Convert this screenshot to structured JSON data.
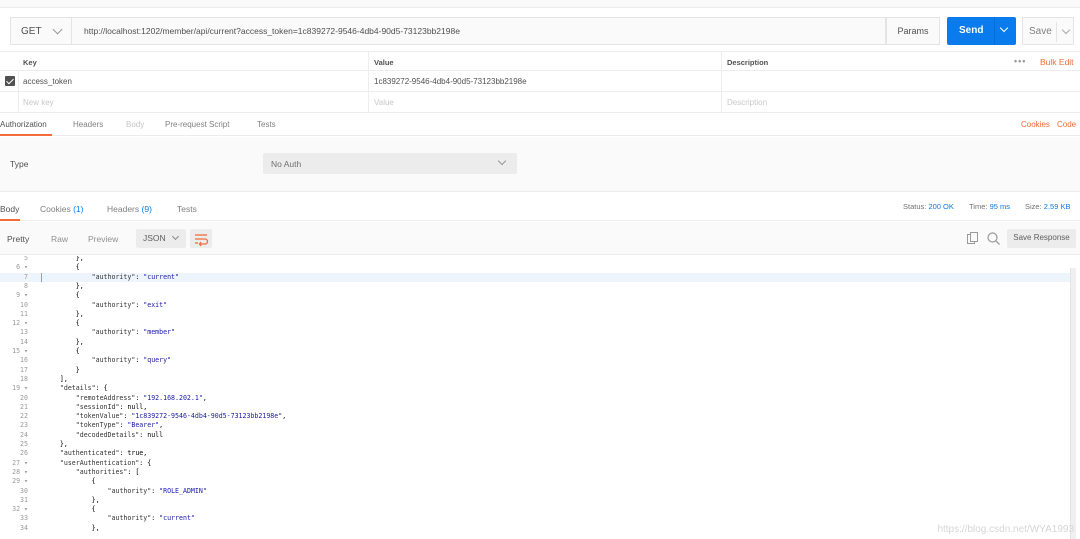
{
  "request": {
    "method": "GET",
    "url": "http://localhost:1202/member/api/current?access_token=1c839272-9546-4db4-90d5-73123bb2198e",
    "params_label": "Params",
    "send_label": "Send",
    "save_label": "Save"
  },
  "params_table": {
    "headers": {
      "key": "Key",
      "value": "Value",
      "description": "Description"
    },
    "bulk_edit": "Bulk Edit",
    "more": "•••",
    "rows": [
      {
        "key": "access_token",
        "value": "1c839272-9546-4db4-90d5-73123bb2198e",
        "description": ""
      }
    ],
    "placeholder": {
      "key": "New key",
      "value": "Value",
      "description": "Description"
    }
  },
  "request_tabs": {
    "items": [
      "Authorization",
      "Headers",
      "Body",
      "Pre-request Script",
      "Tests"
    ],
    "cookies": "Cookies",
    "code": "Code"
  },
  "auth": {
    "type_label": "Type",
    "selected": "No Auth"
  },
  "response_tabs": {
    "body": "Body",
    "cookies": "Cookies",
    "cookies_count": "(1)",
    "headers": "Headers",
    "headers_count": "(9)",
    "tests": "Tests",
    "status_label": "Status:",
    "status_value": "200 OK",
    "time_label": "Time:",
    "time_value": "95 ms",
    "size_label": "Size:",
    "size_value": "2.59 KB"
  },
  "toolbar": {
    "pretty": "Pretty",
    "raw": "Raw",
    "preview": "Preview",
    "format": "JSON",
    "save_response": "Save Response"
  },
  "code_lines": [
    {
      "n": "5",
      "t": "        },"
    },
    {
      "n": "6 ▾",
      "t": "        {"
    },
    {
      "n": "7",
      "t": "            \"authority\": \"current\"",
      "hl": true
    },
    {
      "n": "8",
      "t": "        },"
    },
    {
      "n": "9 ▾",
      "t": "        {"
    },
    {
      "n": "10",
      "t": "            \"authority\": \"exit\""
    },
    {
      "n": "11",
      "t": "        },"
    },
    {
      "n": "12 ▾",
      "t": "        {"
    },
    {
      "n": "13",
      "t": "            \"authority\": \"member\""
    },
    {
      "n": "14",
      "t": "        },"
    },
    {
      "n": "15 ▾",
      "t": "        {"
    },
    {
      "n": "16",
      "t": "            \"authority\": \"query\""
    },
    {
      "n": "17",
      "t": "        }"
    },
    {
      "n": "18",
      "t": "    ],"
    },
    {
      "n": "19 ▾",
      "t": "    \"details\": {"
    },
    {
      "n": "20",
      "t": "        \"remoteAddress\": \"192.168.202.1\","
    },
    {
      "n": "21",
      "t": "        \"sessionId\": null,"
    },
    {
      "n": "22",
      "t": "        \"tokenValue\": \"1c839272-9546-4db4-90d5-73123bb2198e\","
    },
    {
      "n": "23",
      "t": "        \"tokenType\": \"Bearer\","
    },
    {
      "n": "24",
      "t": "        \"decodedDetails\": null"
    },
    {
      "n": "25",
      "t": "    },"
    },
    {
      "n": "26",
      "t": "    \"authenticated\": true,"
    },
    {
      "n": "27 ▾",
      "t": "    \"userAuthentication\": {"
    },
    {
      "n": "28 ▾",
      "t": "        \"authorities\": ["
    },
    {
      "n": "29 ▾",
      "t": "            {"
    },
    {
      "n": "30",
      "t": "                \"authority\": \"ROLE_ADMIN\""
    },
    {
      "n": "31",
      "t": "            },"
    },
    {
      "n": "32 ▾",
      "t": "            {"
    },
    {
      "n": "33",
      "t": "                \"authority\": \"current\""
    },
    {
      "n": "34",
      "t": "            },"
    }
  ],
  "watermark": "https://blog.csdn.net/WYA1993"
}
